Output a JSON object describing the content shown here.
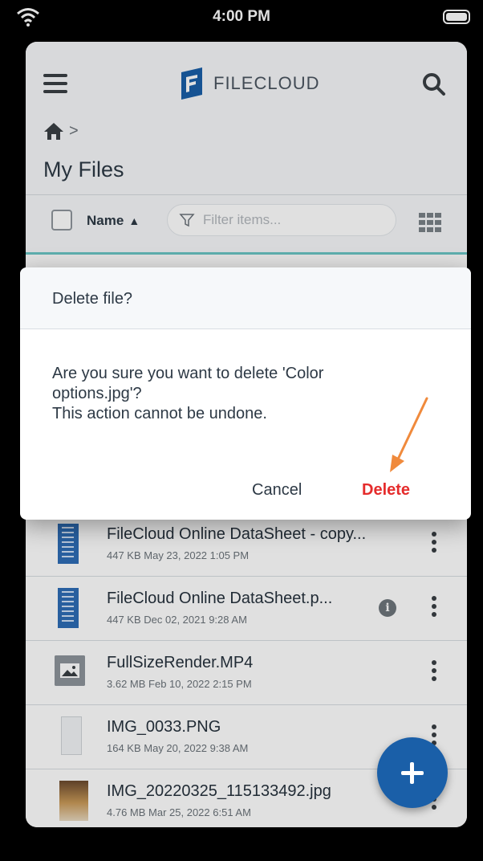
{
  "status_bar": {
    "time": "4:00 PM"
  },
  "header": {
    "logo_text": "FILECLOUD",
    "breadcrumb_separator": ">",
    "page_title": "My Files"
  },
  "toolbar": {
    "sort_label": "Name",
    "sort_indicator": "▲",
    "filter_placeholder": "Filter items..."
  },
  "files": [
    {
      "name": "FileCloud Online DataSheet - copy...",
      "meta": "447 KB May 23, 2022 1:05 PM",
      "thumb": "document"
    },
    {
      "name": "FileCloud Online DataSheet.p...",
      "meta": "447 KB Dec 02, 2021 9:28 AM",
      "thumb": "document",
      "info_badge": "i"
    },
    {
      "name": "FullSizeRender.MP4",
      "meta": "3.62 MB Feb 10, 2022 2:15 PM",
      "thumb": "image-placeholder"
    },
    {
      "name": "IMG_0033.PNG",
      "meta": "164 KB May 20, 2022 9:38 AM",
      "thumb": "screenshot"
    },
    {
      "name": "IMG_20220325_115133492.jpg",
      "meta": "4.76 MB Mar 25, 2022 6:51 AM",
      "thumb": "photo"
    }
  ],
  "dialog": {
    "title": "Delete file?",
    "message_line1": "Are you sure you want to delete 'Color",
    "message_line2": "options.jpg'?",
    "message_line3": "This action cannot be undone.",
    "cancel_label": "Cancel",
    "delete_label": "Delete"
  },
  "colors": {
    "brand_blue": "#1a5fa8",
    "delete_red": "#e52c2c",
    "annotation_arrow": "#f08a3c",
    "accent_teal": "#6cc7c7"
  }
}
